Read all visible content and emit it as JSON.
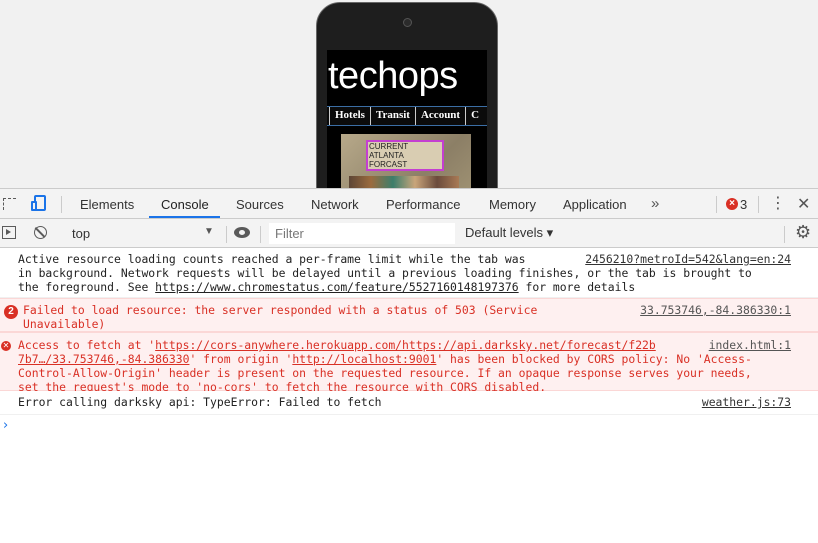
{
  "preview": {
    "logo_text": "techops",
    "nav_items": [
      "Hotels",
      "Transit",
      "Account",
      "C"
    ],
    "weather_label": "CURRENT ATLANTA FORCAST"
  },
  "devtools": {
    "tabs": [
      "Elements",
      "Console",
      "Sources",
      "Network",
      "Performance",
      "Memory",
      "Application"
    ],
    "active_tab": "Console",
    "more_tabs_glyph": "»",
    "error_count": "3",
    "menu_glyph": "⋮",
    "close_glyph": "✕"
  },
  "filterbar": {
    "context": "top",
    "filter_placeholder": "Filter",
    "levels": "Default levels ▾",
    "settings_glyph": "⚙"
  },
  "messages": [
    {
      "level": "info",
      "lines": [
        "Active resource loading counts reached a per-frame limit while the tab was ",
        "in background. Network requests will be delayed until a previous loading finishes, or the tab is brought to",
        "the foreground. See "
      ],
      "link": "https://www.chromestatus.com/feature/5527160148197376",
      "after_link": " for more details",
      "source": "2456210?metroId=542&lang=en:24"
    },
    {
      "level": "error",
      "repeat_count": "2",
      "lines": [
        "Failed to load resource: the server responded with a status of 503 (Service",
        "Unavailable)"
      ],
      "source": "33.753746,-84.386330:1"
    },
    {
      "level": "error",
      "icon": "✕",
      "line1_prefix": "Access to fetch at '",
      "line1_link": "https://cors-anywhere.herokuapp.com/https://api.darksky.net/forecast/f22b",
      "line2_link": "7b7…/33.753746,-84.386330",
      "line2_mid": "' from origin '",
      "line2_link2": "http://localhost:9001",
      "line2_suffix": "' has been blocked by CORS policy: No 'Access-",
      "line3": "Control-Allow-Origin' header is present on the requested resource. If an opaque response serves your needs,",
      "line4": "set the request's mode to 'no-cors' to fetch the resource with CORS disabled.",
      "source": "index.html:1"
    },
    {
      "level": "log",
      "text": "Error calling darksky api: TypeError: Failed to fetch",
      "source": "weather.js:73"
    }
  ],
  "prompt_glyph": "›"
}
